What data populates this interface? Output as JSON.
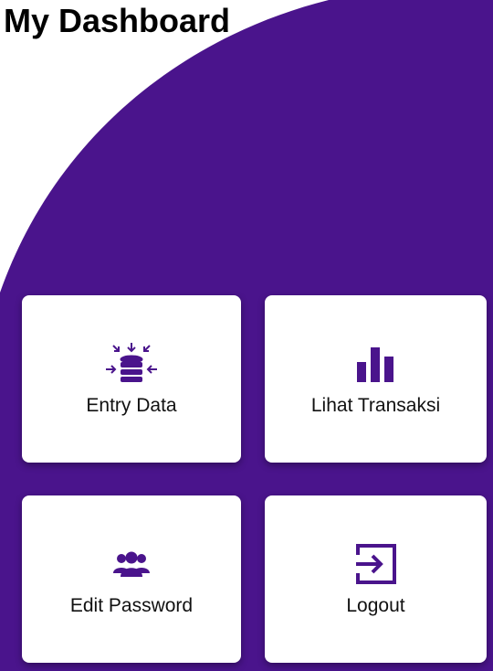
{
  "header": {
    "title": "My Dashboard"
  },
  "theme": {
    "primary": "#4a148c",
    "background": "#ffffff",
    "card": "#ffffff"
  },
  "menu": [
    {
      "label": "Entry Data",
      "icon": "database-import-icon"
    },
    {
      "label": "Lihat Transaksi",
      "icon": "bar-chart-icon"
    },
    {
      "label": "Edit Password",
      "icon": "users-group-icon"
    },
    {
      "label": "Logout",
      "icon": "logout-icon"
    }
  ]
}
